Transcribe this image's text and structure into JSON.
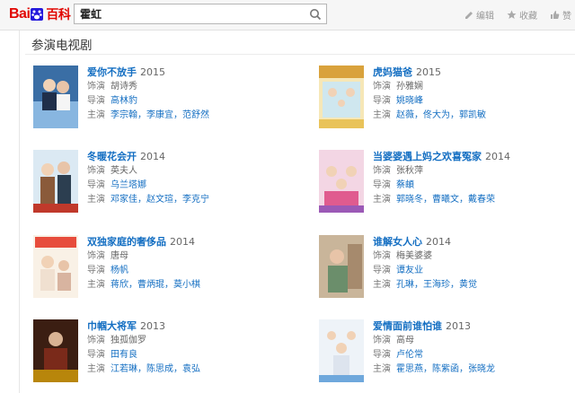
{
  "header": {
    "logo_text_left": "Bai",
    "logo_text_right": "百科",
    "search_value": "霍虹",
    "actions": [
      {
        "label": "编辑",
        "icon": "edit-icon"
      },
      {
        "label": "收藏",
        "icon": "star-icon"
      },
      {
        "label": "赞",
        "icon": "thumbs-up-icon"
      }
    ]
  },
  "section": {
    "title": "参演电视剧"
  },
  "labels": {
    "role": "饰演",
    "director": "导演",
    "cast": "主演"
  },
  "works": [
    {
      "title": "爱你不放手",
      "year": "2015",
      "role": "胡诗秀",
      "director": "高林豹",
      "cast": [
        "李宗翰",
        "李康宜",
        "范舒然"
      ]
    },
    {
      "title": "虎妈猫爸",
      "year": "2015",
      "role": "孙雅娴",
      "director": "姚晓峰",
      "cast": [
        "赵薇",
        "佟大为",
        "郭凯敏"
      ]
    },
    {
      "title": "冬暖花会开",
      "year": "2014",
      "role": "英夫人",
      "director": "乌兰塔娜",
      "cast": [
        "邓家佳",
        "赵文瑄",
        "李克宁"
      ]
    },
    {
      "title": "当婆婆遇上妈之欢喜冤家",
      "year": "2014",
      "role": "张秋萍",
      "director": "蔡頔",
      "cast": [
        "郭晓冬",
        "曹曦文",
        "戴春荣"
      ]
    },
    {
      "title": "双独家庭的奢侈品",
      "year": "2014",
      "role": "唐母",
      "director": "杨帆",
      "cast": [
        "蒋欣",
        "曹炳琨",
        "莫小棋"
      ]
    },
    {
      "title": "谁解女人心",
      "year": "2014",
      "role": "梅美婆婆",
      "director": "谭友业",
      "cast": [
        "孔琳",
        "王海珍",
        "黄觉"
      ]
    },
    {
      "title": "巾帼大将军",
      "year": "2013",
      "role": "独孤伽罗",
      "director": "田有良",
      "cast": [
        "江若琳",
        "陈思成",
        "袁弘"
      ]
    },
    {
      "title": "爱情面前谁怕谁",
      "year": "2013",
      "role": "高母",
      "director": "卢伦常",
      "cast": [
        "霍思燕",
        "陈紫函",
        "张晓龙"
      ]
    }
  ],
  "colors": {
    "link": "#136ec2",
    "brand_red": "#e10602",
    "brand_blue": "#2319dc"
  }
}
